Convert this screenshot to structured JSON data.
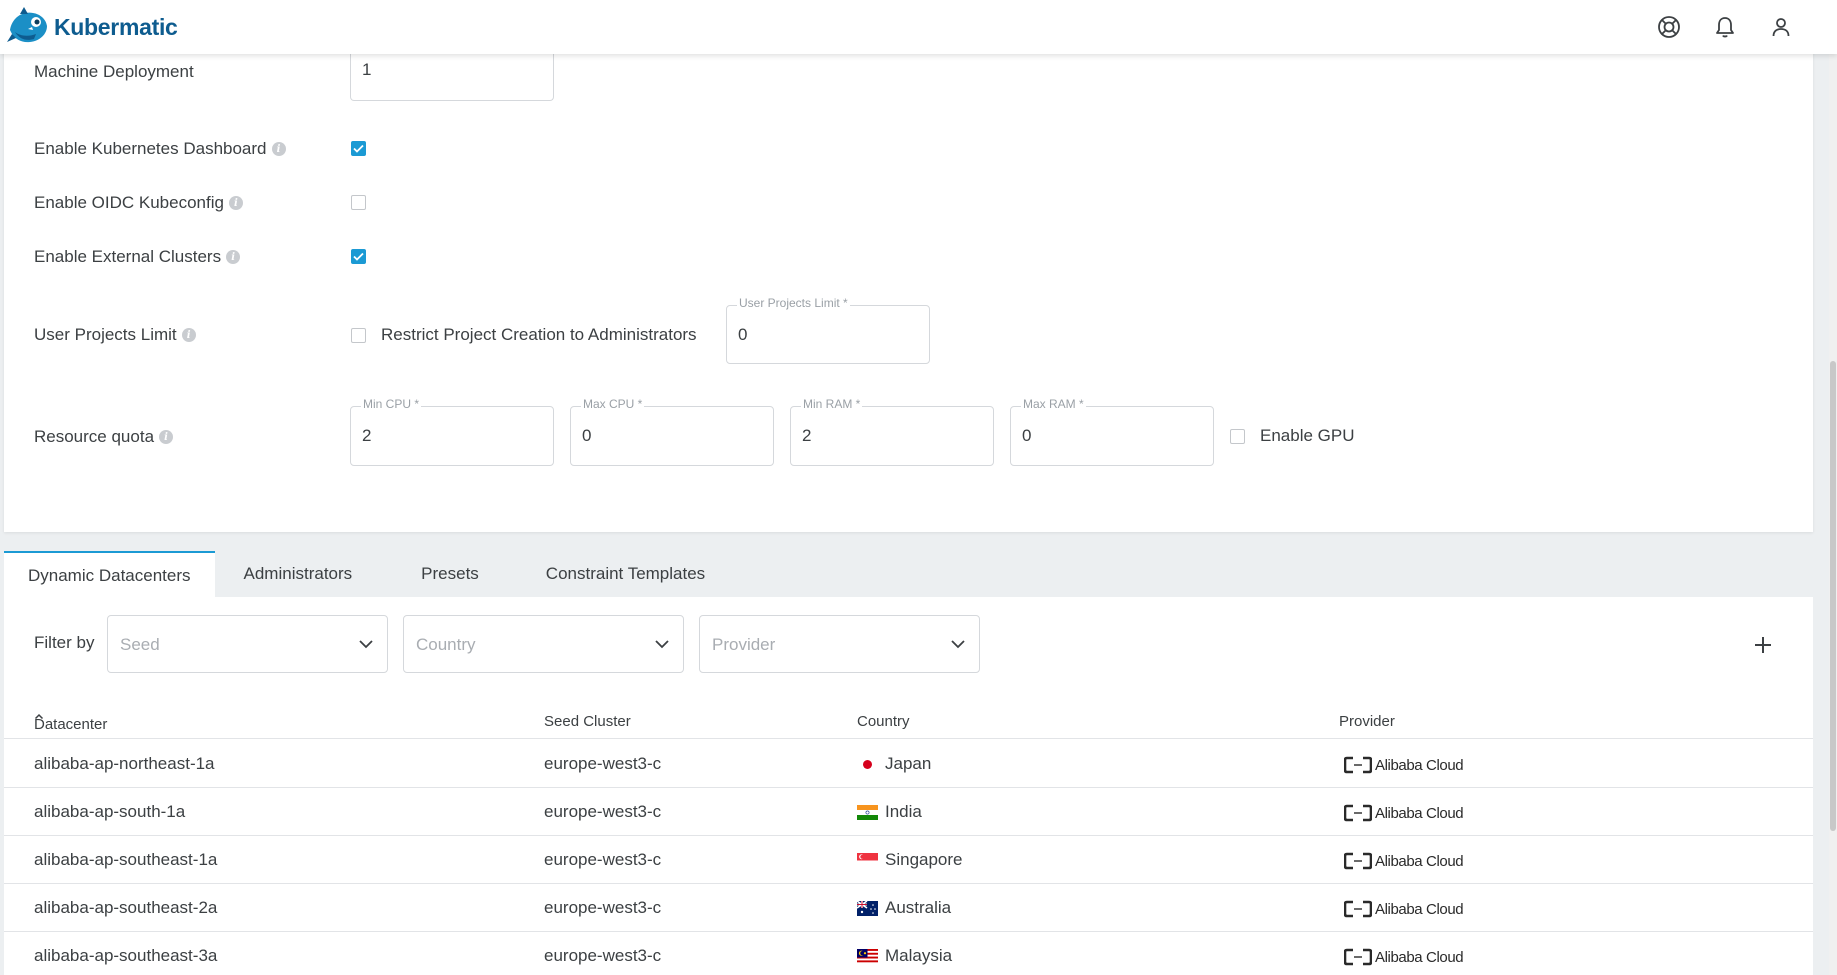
{
  "app": {
    "name": "Kubermatic"
  },
  "topbar": {
    "icons": [
      "help-icon",
      "bell-icon",
      "user-icon"
    ]
  },
  "settings": {
    "machine_deployment": {
      "label": "Machine Deployment",
      "value": "1"
    },
    "k8s_dashboard": {
      "label": "Enable Kubernetes Dashboard",
      "checked": true
    },
    "oidc_kubeconfig": {
      "label": "Enable OIDC Kubeconfig",
      "checked": false
    },
    "external_clusters": {
      "label": "Enable External Clusters",
      "checked": true
    },
    "user_projects_limit": {
      "label": "User Projects Limit",
      "restrict_label": "Restrict Project Creation to Administrators",
      "restrict_checked": false,
      "field_label": "User Projects Limit *",
      "value": "0"
    },
    "resource_quota": {
      "label": "Resource quota",
      "min_cpu": {
        "label": "Min CPU *",
        "value": "2"
      },
      "max_cpu": {
        "label": "Max CPU *",
        "value": "0"
      },
      "min_ram": {
        "label": "Min RAM *",
        "value": "2"
      },
      "max_ram": {
        "label": "Max RAM *",
        "value": "0"
      },
      "gpu_label": "Enable GPU",
      "gpu_checked": false
    }
  },
  "tabs": [
    {
      "label": "Dynamic Datacenters",
      "active": true
    },
    {
      "label": "Administrators",
      "active": false
    },
    {
      "label": "Presets",
      "active": false
    },
    {
      "label": "Constraint Templates",
      "active": false
    }
  ],
  "filters": {
    "label": "Filter by",
    "seed": {
      "placeholder": "Seed"
    },
    "country": {
      "placeholder": "Country"
    },
    "provider": {
      "placeholder": "Provider"
    }
  },
  "table": {
    "headers": [
      "Datacenter",
      "Seed Cluster",
      "Country",
      "Provider"
    ],
    "sorted_column": "Datacenter",
    "rows": [
      {
        "datacenter": "alibaba-ap-northeast-1a",
        "seed": "europe-west3-c",
        "country": "Japan",
        "flag": "japan-flag-icon",
        "provider": "Alibaba Cloud"
      },
      {
        "datacenter": "alibaba-ap-south-1a",
        "seed": "europe-west3-c",
        "country": "India",
        "flag": "india-flag-icon",
        "provider": "Alibaba Cloud"
      },
      {
        "datacenter": "alibaba-ap-southeast-1a",
        "seed": "europe-west3-c",
        "country": "Singapore",
        "flag": "singapore-flag-icon",
        "provider": "Alibaba Cloud"
      },
      {
        "datacenter": "alibaba-ap-southeast-2a",
        "seed": "europe-west3-c",
        "country": "Australia",
        "flag": "australia-flag-icon",
        "provider": "Alibaba Cloud"
      },
      {
        "datacenter": "alibaba-ap-southeast-3a",
        "seed": "europe-west3-c",
        "country": "Malaysia",
        "flag": "malaysia-flag-icon",
        "provider": "Alibaba Cloud"
      }
    ]
  },
  "colors": {
    "accent": "#1b9ad4",
    "brand": "#0e5c8f",
    "background": "#eceff1"
  }
}
